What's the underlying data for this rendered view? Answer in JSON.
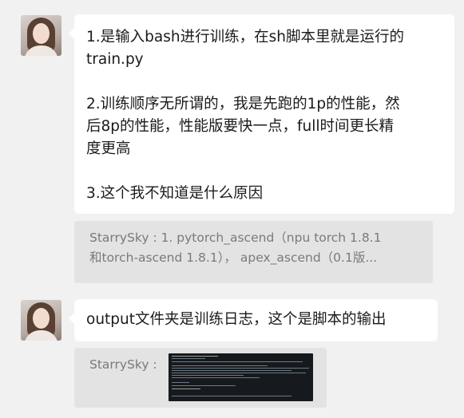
{
  "messages": [
    {
      "sender": "other",
      "paragraphs": [
        "1.是输入bash进行训练，在sh脚本里就是运行的train.py",
        "2.训练顺序无所谓的，我是先跑的1p的性能，然后8p的性能，性能版要快一点，full时间更长精度更高",
        "3.这个我不知道是什么原因"
      ],
      "lines": [
        "1.是输入bash进行训练，在sh脚本里就是运行的",
        "train.py",
        "",
        "2.训练顺序无所谓的，我是先跑的1p的性能，然",
        "后8p的性能，性能版要快一点，full时间更长精",
        "度更高",
        "",
        "3.这个我不知道是什么原因"
      ]
    },
    {
      "sender": "other",
      "paragraphs": [
        "output文件夹是训练日志，这个是脚本的输出"
      ]
    }
  ],
  "quotes": [
    {
      "lines": [
        "StarrySky : 1. pytorch_ascend（npu torch 1.8.1",
        "和torch-ascend 1.8.1）， apex_ascend（0.1版..."
      ]
    },
    {
      "prefix": "StarrySky :",
      "attachment": "terminal-screenshot"
    }
  ],
  "colors": {
    "background": "#f1f1f1",
    "bubble": "#ffffff",
    "quote_bg": "#e3e3e3",
    "quote_text": "#7a7a7a",
    "text": "#1b1b1b"
  }
}
